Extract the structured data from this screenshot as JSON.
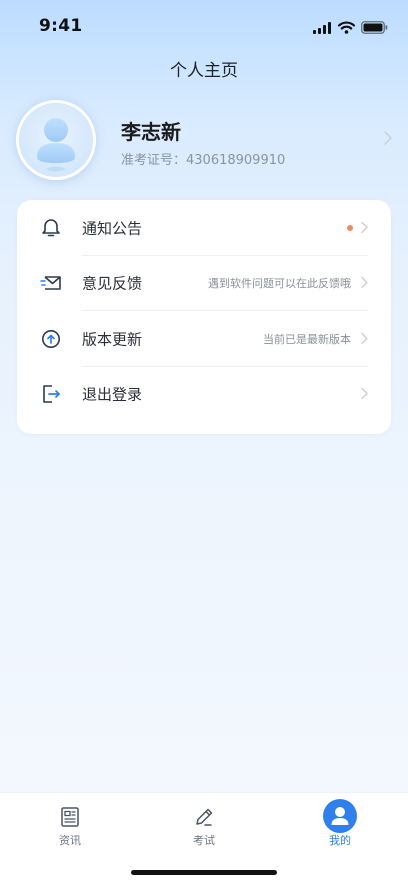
{
  "status_bar": {
    "time": "9:41",
    "icons": [
      "signal-icon",
      "wifi-icon",
      "battery-icon"
    ]
  },
  "header": {
    "title": "个人主页"
  },
  "profile": {
    "name": "李志新",
    "exam_number": "准考证号：430618909910",
    "avatar_icon": "user-avatar-icon"
  },
  "menu": {
    "items": [
      {
        "label": "通知公告",
        "icon": "bell-icon",
        "has_dot": true,
        "hint": ""
      },
      {
        "label": "意见反馈",
        "icon": "mail-icon",
        "has_dot": false,
        "hint": "遇到软件问题可以在此反馈哦"
      },
      {
        "label": "版本更新",
        "icon": "upgrade-icon",
        "has_dot": false,
        "hint": "当前已是最新版本"
      },
      {
        "label": "退出登录",
        "icon": "logout-icon",
        "has_dot": false,
        "hint": ""
      }
    ]
  },
  "tab_bar": {
    "tabs": [
      {
        "label": "资讯",
        "icon": "news-icon",
        "active": false
      },
      {
        "label": "考试",
        "icon": "pencil-icon",
        "active": false
      },
      {
        "label": "我的",
        "icon": "user-icon",
        "active": true
      }
    ]
  },
  "colors": {
    "accent": "#2f80ed",
    "notification_dot": "#f08a5d",
    "icon_dark": "#2f3a4f"
  }
}
